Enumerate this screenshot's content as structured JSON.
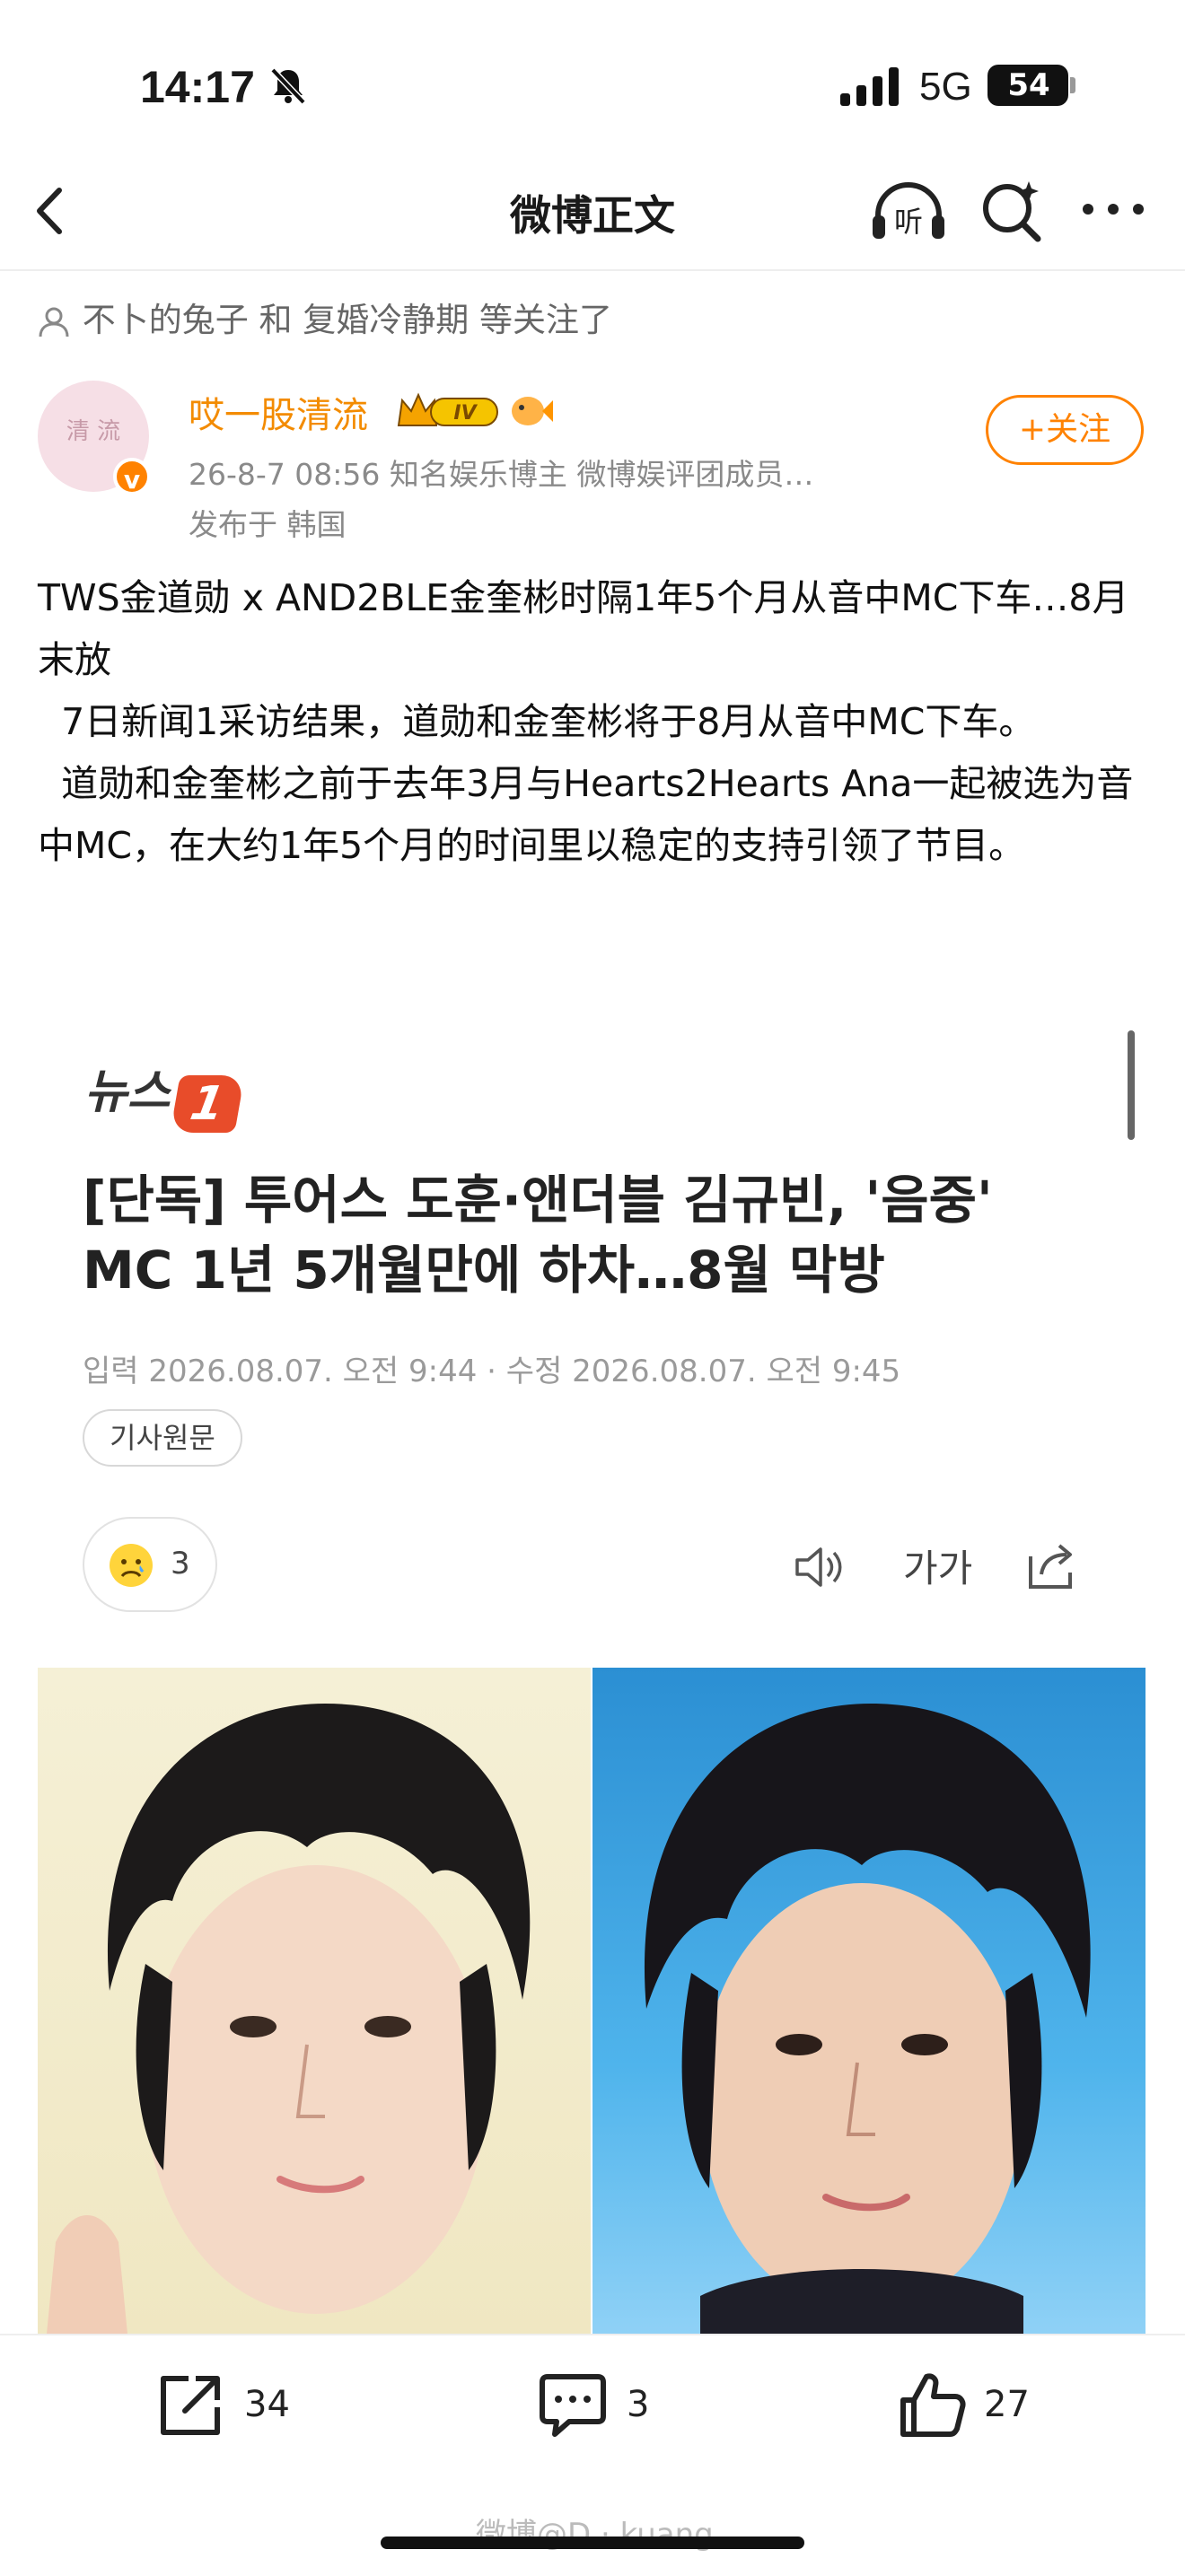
{
  "status_bar": {
    "time": "14:17",
    "network": "5G",
    "battery": "54",
    "icons": [
      "bell-slash-icon",
      "signal-bars-icon",
      "battery-icon"
    ]
  },
  "nav": {
    "title": "微博正文",
    "icons": [
      "back-chevron-icon",
      "listen-headphones-icon",
      "search-sparkle-icon",
      "more-dots-icon"
    ]
  },
  "followed_by": "不卜的兔子 和 复婚冷静期 等关注了",
  "author": {
    "name": "哎一股清流",
    "avatar_text": "清 流",
    "level_badge": "IV",
    "verified_badge": "v",
    "meta": "26-8-7 08:56   知名娱乐博主     微博娱评团成员…",
    "location": "发布于 韩国",
    "follow_label": "+关注"
  },
  "post": {
    "paragraphs": [
      "TWS金道勋 x AND2BLE金奎彬时隔1年5个月从音中MC下车…8月末放",
      "  7日新闻1采访结果，道勋和金奎彬将于8月从音中MC下车。",
      "  道勋和金奎彬之前于去年3月与Hearts2Hearts Ana一起被选为音中MC，在大约1年5个月的时间里以稳定的支持引领了节目。"
    ]
  },
  "article": {
    "logo_word": "뉴스",
    "logo_num": "1",
    "headline": "[단독] 투어스 도훈·앤더블 김규빈, '음중' MC 1년 5개월만에 하차…8월 막방",
    "dates": "입력 2026.08.07. 오전 9:44 · 수정 2026.08.07. 오전 9:45",
    "original_label": "기사원문",
    "reaction_count": "3",
    "font_size_label": "가가"
  },
  "bottom_bar": {
    "share_count": "34",
    "comment_count": "3",
    "like_count": "27"
  },
  "watermark": "微博@D · kuang",
  "colors": {
    "accent_orange": "#ff8200",
    "author_name": "#f38b00",
    "news_logo": "#e84c2a"
  }
}
